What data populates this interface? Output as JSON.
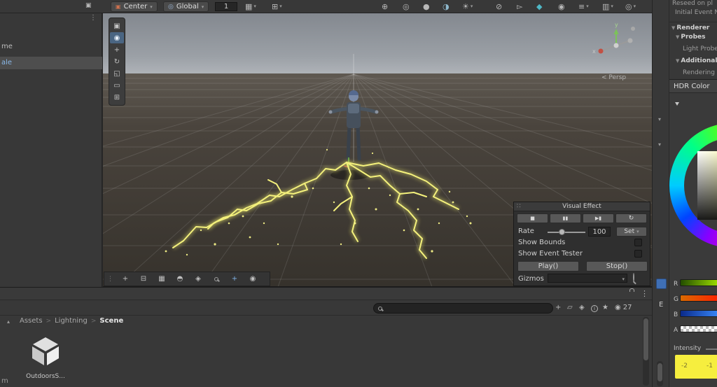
{
  "topbar": {
    "window_icon": "▣",
    "center_button": {
      "icon": "▣",
      "label": "Center",
      "arrow": "▾"
    },
    "global_button": {
      "icon": "◎",
      "label": "Global",
      "arrow": "▾"
    },
    "layer_value": "1",
    "grid_button": {
      "glyph": "▦",
      "arrow": "▾"
    },
    "snap_button": {
      "glyph": "⊞",
      "arrow": "▾"
    },
    "center_icons": [
      {
        "glyph": "⊕"
      },
      {
        "glyph": "◎"
      },
      {
        "glyph": "●"
      },
      {
        "glyph": "◑"
      },
      {
        "glyph": "☀",
        "arrow": "▾"
      }
    ],
    "right_icons": [
      {
        "glyph": "⊘"
      },
      {
        "glyph": "▻"
      },
      {
        "glyph": "◆"
      },
      {
        "glyph": "◉"
      },
      {
        "glyph": "≡",
        "arrow": "▾"
      },
      {
        "glyph": "▥",
        "arrow": "▾"
      },
      {
        "glyph": "◎",
        "arrow": "▾"
      }
    ]
  },
  "hierarchy": {
    "menu_icon": "⋮",
    "items": [
      {
        "label": "me"
      },
      {
        "label": "ale"
      }
    ]
  },
  "scene": {
    "handle_icon": "⋮",
    "tools": [
      {
        "glyph": "▣"
      },
      {
        "glyph": "◉"
      },
      {
        "glyph": "+"
      },
      {
        "glyph": "↻"
      },
      {
        "glyph": "◱"
      },
      {
        "glyph": "▭"
      },
      {
        "glyph": "⊞"
      }
    ],
    "bottom_tools": [
      {
        "glyph": "+"
      },
      {
        "glyph": "⊟"
      },
      {
        "glyph": "▦"
      },
      {
        "glyph": "◓"
      },
      {
        "glyph": "◈"
      },
      {
        "glyph": ""
      },
      {
        "glyph": "+"
      },
      {
        "glyph": "◉"
      }
    ],
    "gizmo": {
      "axis_x": "x",
      "axis_y": "y",
      "persp_label": "< Persp"
    }
  },
  "vfx_panel": {
    "drag_handle": "∷",
    "title": "Visual Effect",
    "playback": [
      {
        "glyph": "■"
      },
      {
        "glyph": "▮▮"
      },
      {
        "glyph": "▶▮"
      },
      {
        "glyph": "↻"
      }
    ],
    "rate_label": "Rate",
    "rate_value": "100",
    "set_label": "Set",
    "set_arrow": "▾",
    "show_bounds_label": "Show Bounds",
    "show_event_tester_label": "Show Event Tester",
    "play_label": "Play()",
    "stop_label": "Stop()",
    "gizmos_label": "Gizmos",
    "gizmos_arrow": "▾"
  },
  "right_strip": {
    "arrow_top": "▾",
    "arrow_mid": "▾",
    "tab_label": "E"
  },
  "inspector": {
    "reseed_label": "Reseed on pl",
    "initial_event_label": "Initial Event N",
    "renderer_fold": "▼",
    "renderer_label": "Renderer",
    "probes_fold": "▼",
    "probes_label": "Probes",
    "light_probe_label": "Light Probe",
    "additional_fold": "▼",
    "additional_label": "Additional S",
    "rendering_label": "Rendering",
    "hdr": {
      "title": "HDR Color",
      "channels": [
        {
          "label": "R"
        },
        {
          "label": "G"
        },
        {
          "label": "B"
        },
        {
          "label": "A"
        }
      ],
      "intensity_label": "Intensity",
      "tick_left": "-2",
      "tick_right": "-1"
    }
  },
  "project": {
    "menu_icon": "⋮",
    "toolbar_icons": [
      {
        "glyph": "+"
      },
      {
        "glyph": "▱"
      },
      {
        "glyph": "◈"
      },
      {
        "glyph": "i"
      },
      {
        "glyph": "★"
      }
    ],
    "eye_icon": "◉",
    "visible_count": "27",
    "collapse_arrow": "▴",
    "breadcrumb": {
      "root": "Assets",
      "sep": ">",
      "folder": "Lightning",
      "current": "Scene"
    },
    "asset_label": "OutdoorsS...",
    "corner_label": "m"
  }
}
